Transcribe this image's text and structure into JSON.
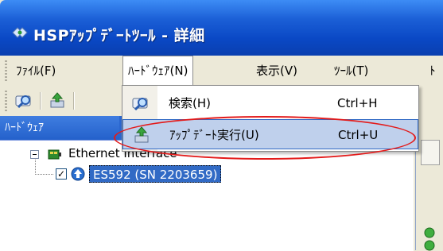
{
  "window": {
    "title": "HSPｱｯﾌﾟﾃﾞｰﾄﾂｰﾙ - 詳細",
    "icon": "hsp-app-icon"
  },
  "menubar": {
    "items": [
      {
        "label": "ﾌｧｲﾙ(F)"
      },
      {
        "label": "ﾊｰﾄﾞｳｪｱ(N)"
      },
      {
        "label": "表示(V)"
      },
      {
        "label": "ﾂｰﾙ(T)"
      },
      {
        "label": "ﾄ"
      }
    ]
  },
  "toolbar": {
    "buttons": [
      {
        "icon": "search-icon"
      },
      {
        "icon": "update-icon"
      }
    ]
  },
  "hardware_menu": {
    "items": [
      {
        "label": "検索(H)",
        "shortcut": "Ctrl+H",
        "icon": "search-icon",
        "highlighted": false
      },
      {
        "label": "ｱｯﾌﾟﾃﾞｰﾄ実行(U)",
        "shortcut": "Ctrl+U",
        "icon": "update-icon",
        "highlighted": true
      }
    ]
  },
  "left_panel": {
    "header": "ﾊｰﾄﾞｳｪｱ",
    "tree": {
      "root": {
        "label": "Ethernet Interface",
        "expanded": true
      },
      "child": {
        "label": "ES592 (SN 2203659)",
        "checked": true,
        "selected": true
      }
    }
  },
  "colors": {
    "titlebar": "#0a48c5",
    "selection": "#316ac5",
    "menu_highlight": "#bfd0ec",
    "annotation": "#e31b1b"
  }
}
